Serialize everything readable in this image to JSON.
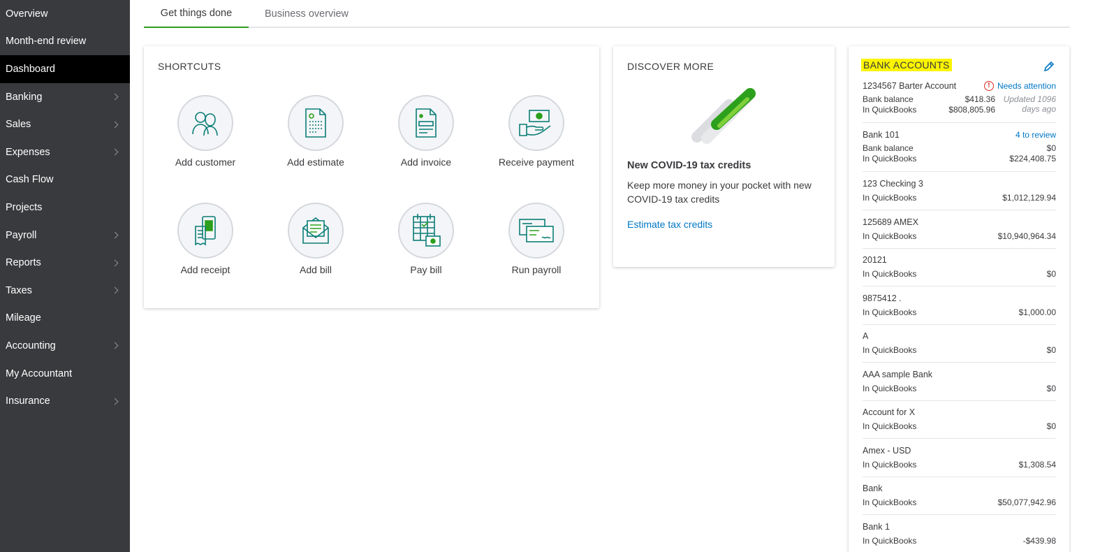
{
  "sidebar": {
    "items": [
      {
        "label": "Overview",
        "chevron": false
      },
      {
        "label": "Month-end review",
        "chevron": false
      },
      {
        "label": "Dashboard",
        "chevron": false,
        "active": true
      },
      {
        "label": "Banking",
        "chevron": true
      },
      {
        "label": "Sales",
        "chevron": true
      },
      {
        "label": "Expenses",
        "chevron": true
      },
      {
        "label": "Cash Flow",
        "chevron": false
      },
      {
        "label": "Projects",
        "chevron": false
      },
      {
        "label": "Payroll",
        "chevron": true
      },
      {
        "label": "Reports",
        "chevron": true
      },
      {
        "label": "Taxes",
        "chevron": true
      },
      {
        "label": "Mileage",
        "chevron": false
      },
      {
        "label": "Accounting",
        "chevron": true
      },
      {
        "label": "My Accountant",
        "chevron": false
      },
      {
        "label": "Insurance",
        "chevron": true
      }
    ]
  },
  "tabs": [
    {
      "label": "Get things done",
      "active": true
    },
    {
      "label": "Business overview",
      "active": false
    }
  ],
  "shortcuts": {
    "title": "SHORTCUTS",
    "items": [
      {
        "label": "Add customer",
        "icon": "customer-icon"
      },
      {
        "label": "Add estimate",
        "icon": "estimate-icon"
      },
      {
        "label": "Add invoice",
        "icon": "invoice-icon"
      },
      {
        "label": "Receive payment",
        "icon": "payment-icon"
      },
      {
        "label": "Add receipt",
        "icon": "receipt-icon"
      },
      {
        "label": "Add bill",
        "icon": "bill-icon"
      },
      {
        "label": "Pay bill",
        "icon": "pay-bill-icon"
      },
      {
        "label": "Run payroll",
        "icon": "payroll-icon"
      }
    ]
  },
  "discover": {
    "title": "DISCOVER MORE",
    "heading": "New COVID-19 tax credits",
    "text": "Keep more money in your pocket with new COVID-19 tax credits",
    "link": "Estimate tax credits"
  },
  "bank": {
    "title": "BANK ACCOUNTS",
    "accounts": [
      {
        "name": "1234567 Barter Account",
        "status": "Needs attention",
        "bank_label": "Bank balance",
        "bank_value": "$418.36",
        "qb_label": "In QuickBooks",
        "qb_value": "$808,805.96",
        "updated": "Updated 1096 days ago"
      },
      {
        "name": "Bank 101",
        "review": "4 to review",
        "bank_label": "Bank balance",
        "bank_value": "$0",
        "qb_label": "In QuickBooks",
        "qb_value": "$224,408.75"
      },
      {
        "name": "123 Checking 3",
        "qb_label": "In QuickBooks",
        "qb_value": "$1,012,129.94"
      },
      {
        "name": "125689 AMEX",
        "qb_label": "In QuickBooks",
        "qb_value": "$10,940,964.34"
      },
      {
        "name": "20121",
        "qb_label": "In QuickBooks",
        "qb_value": "$0"
      },
      {
        "name": "9875412 .",
        "qb_label": "In QuickBooks",
        "qb_value": "$1,000.00"
      },
      {
        "name": "A",
        "qb_label": "In QuickBooks",
        "qb_value": "$0"
      },
      {
        "name": "AAA sample Bank",
        "qb_label": "In QuickBooks",
        "qb_value": "$0"
      },
      {
        "name": "Account for X",
        "qb_label": "In QuickBooks",
        "qb_value": "$0"
      },
      {
        "name": "Amex - USD",
        "qb_label": "In QuickBooks",
        "qb_value": "$1,308.54"
      },
      {
        "name": "Bank",
        "qb_label": "In QuickBooks",
        "qb_value": "$50,077,942.96"
      },
      {
        "name": "Bank 1",
        "qb_label": "In QuickBooks",
        "qb_value": "-$439.98"
      }
    ]
  }
}
